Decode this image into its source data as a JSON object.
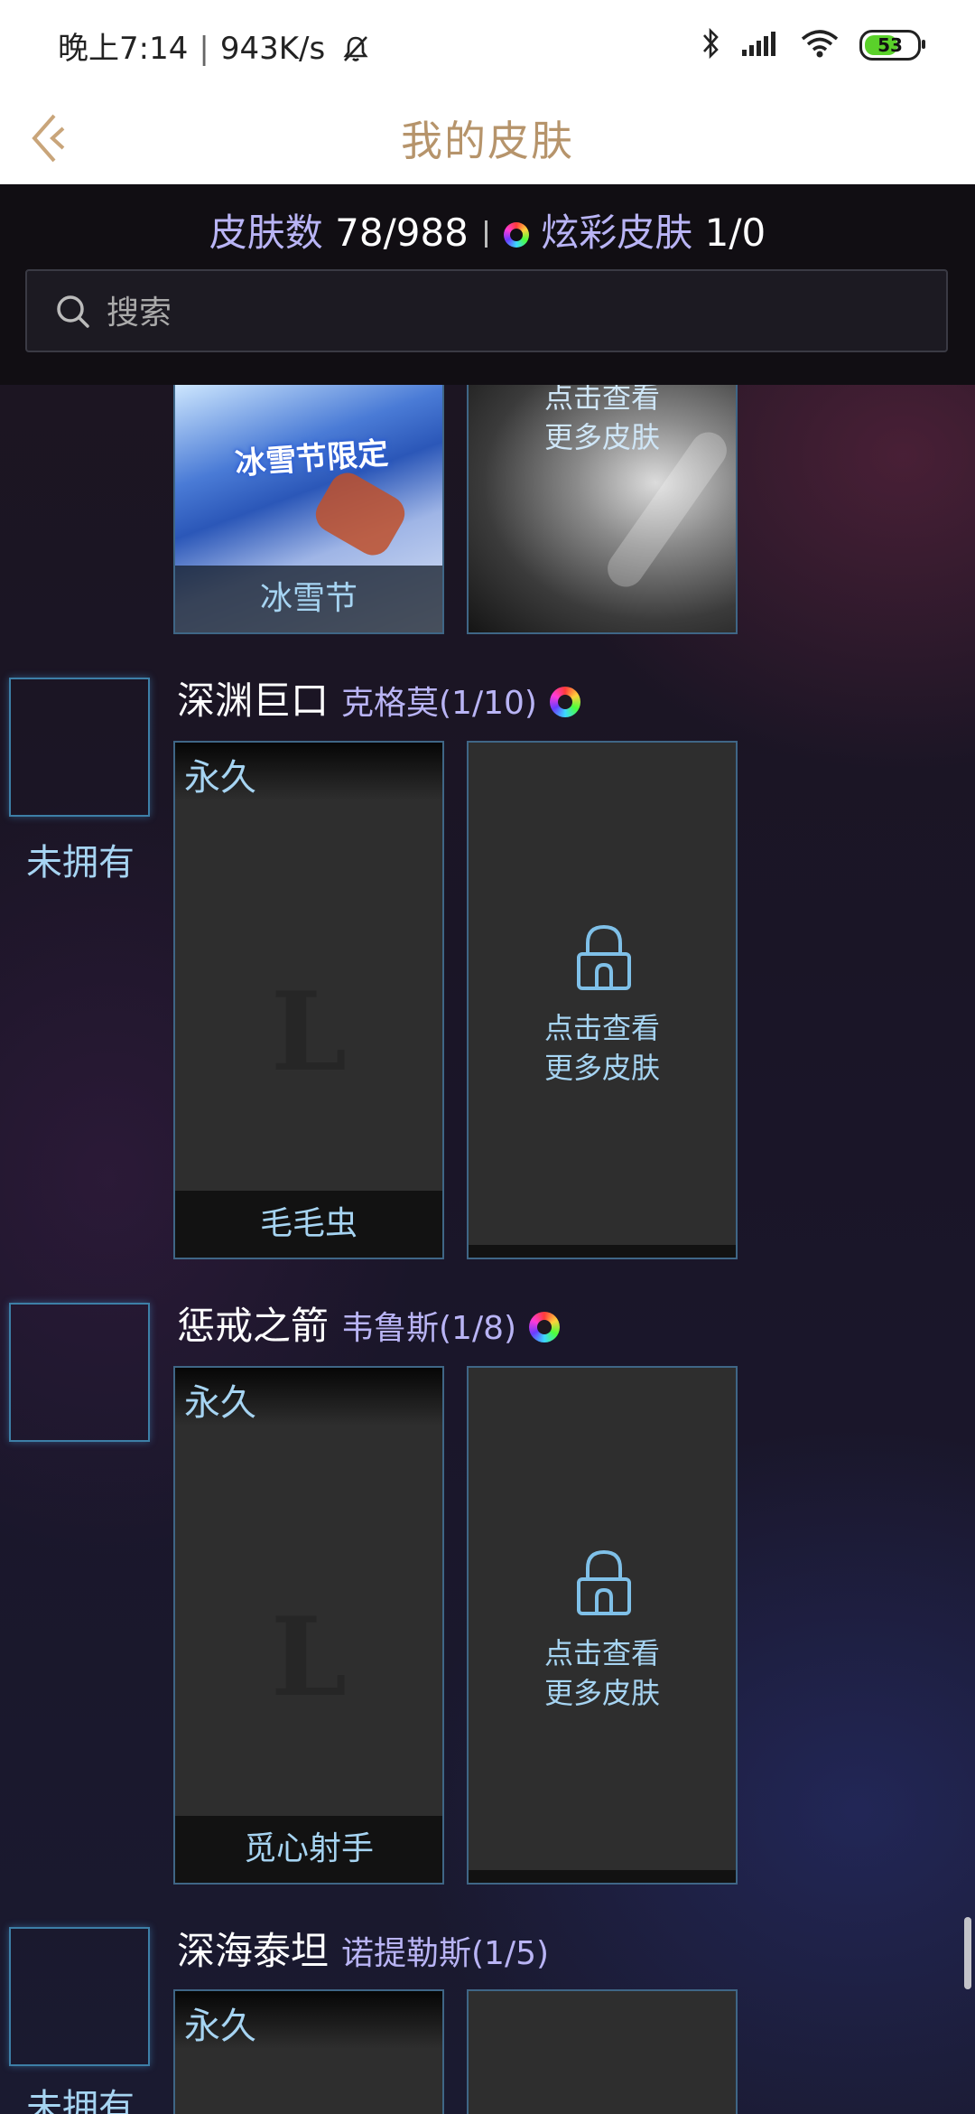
{
  "status_bar": {
    "time": "晚上7:14",
    "speed": "943K/s",
    "battery": "53"
  },
  "header": {
    "title": "我的皮肤"
  },
  "stats": {
    "skins_label": "皮肤数",
    "skins_value": "78/988",
    "chroma_label": "炫彩皮肤",
    "chroma_value": "1/0"
  },
  "search": {
    "placeholder": "搜索"
  },
  "partial_row": {
    "skin_name": "冰雪节",
    "image_label": "冰雪节限定",
    "more_line1": "点击查看",
    "more_line2": "更多皮肤"
  },
  "champions": [
    {
      "title": "深渊巨口",
      "sub": "克格莫(1/10)",
      "status": "未拥有",
      "skin_tag": "永久",
      "skin_mark": "L",
      "skin_name": "毛毛虫",
      "more_line1": "点击查看",
      "more_line2": "更多皮肤"
    },
    {
      "title": "惩戒之箭",
      "sub": "韦鲁斯(1/8)",
      "status": "",
      "skin_tag": "永久",
      "skin_mark": "L",
      "skin_name": "觅心射手",
      "more_line1": "点击查看",
      "more_line2": "更多皮肤"
    },
    {
      "title": "深海泰坦",
      "sub": "诺提勒斯(1/5)",
      "status": "未拥有",
      "skin_tag": "永久"
    }
  ],
  "colors": {
    "accent_gold": "#b6946b",
    "label_purple": "#b9b4f5",
    "text_cyan": "#a6d4f2",
    "card_border": "#3f6686"
  }
}
